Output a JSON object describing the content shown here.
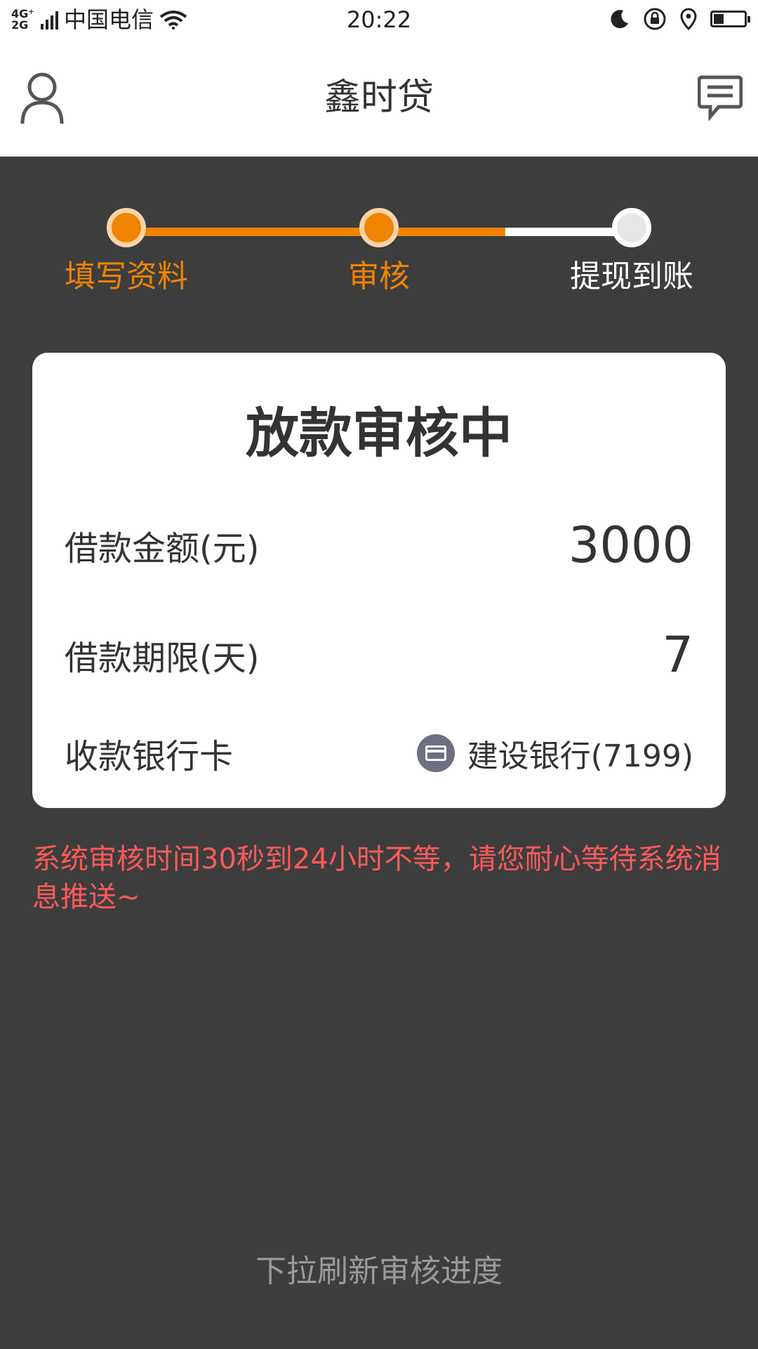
{
  "status_bar": {
    "network": "4G⁺ 2G",
    "carrier": "中国电信",
    "time": "20:22",
    "icons": [
      "signal-icon",
      "wifi-icon",
      "moon-icon",
      "rotation-lock-icon",
      "location-icon",
      "battery-icon"
    ]
  },
  "header": {
    "title": "鑫时贷",
    "left_icon": "user-icon",
    "right_icon": "message-icon"
  },
  "steps": [
    {
      "label": "填写资料",
      "state": "done"
    },
    {
      "label": "审核",
      "state": "current"
    },
    {
      "label": "提现到账",
      "state": "pending"
    }
  ],
  "card": {
    "title": "放款审核中",
    "amount_label": "借款金额(元)",
    "amount_value": "3000",
    "term_label": "借款期限(天)",
    "term_value": "7",
    "bank_label": "收款银行卡",
    "bank_value": "建设银行(7199)",
    "bank_icon": "bank-card-icon"
  },
  "notice": "系统审核时间30秒到24小时不等，请您耐心等待系统消息推送~",
  "pull_hint": "下拉刷新审核进度",
  "colors": {
    "accent": "#f08300",
    "background": "#3d3d3d",
    "notice": "#ff5a5a",
    "pending_dot": "#e6e8e8"
  }
}
